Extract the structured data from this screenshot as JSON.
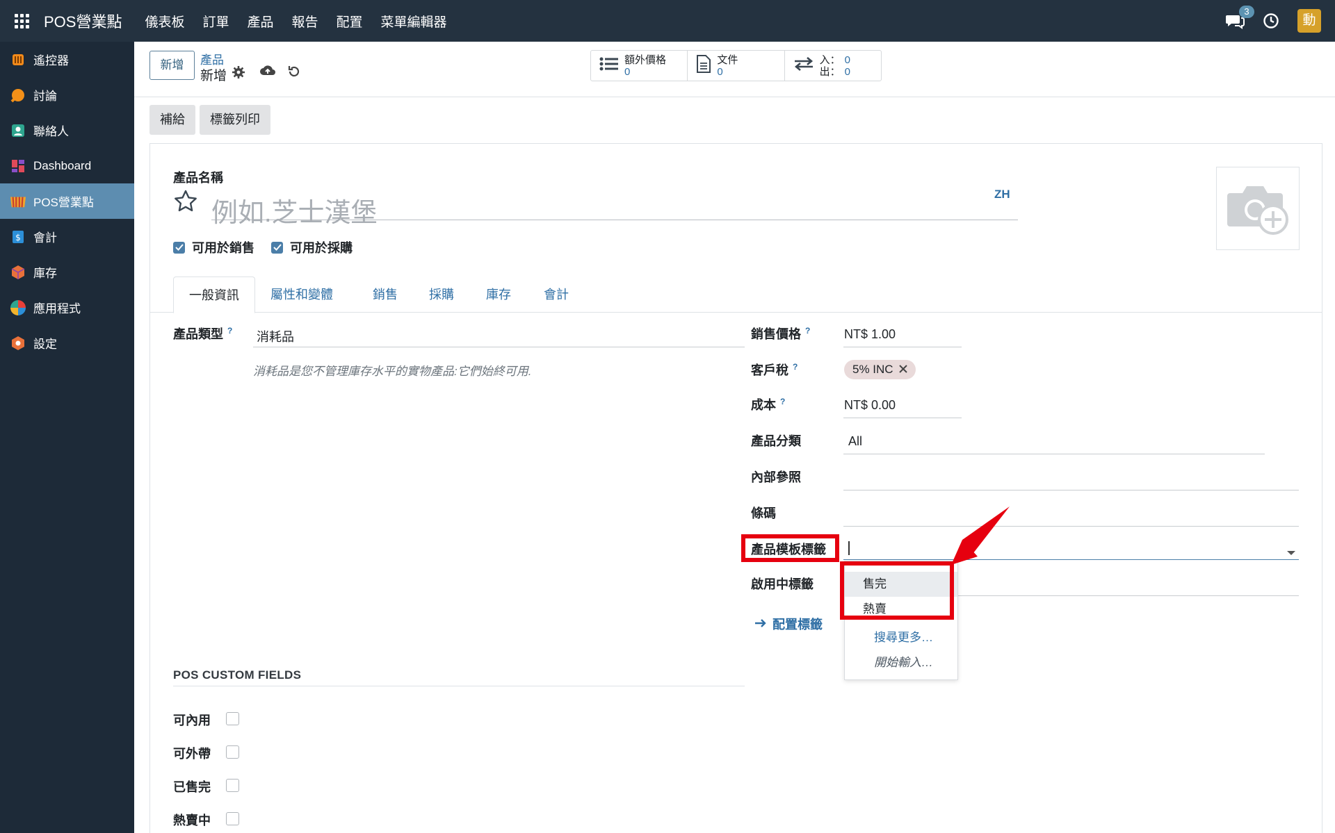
{
  "topbar": {
    "brand": "POS營業點",
    "menu": [
      "儀表板",
      "訂單",
      "產品",
      "報告",
      "配置",
      "菜單編輯器"
    ],
    "chat_badge": "3",
    "avatar_letter": "動"
  },
  "sidebar": {
    "items": [
      {
        "label": "遙控器",
        "icon": "remote-icon"
      },
      {
        "label": "討論",
        "icon": "discuss-icon"
      },
      {
        "label": "聯絡人",
        "icon": "contacts-icon"
      },
      {
        "label": "Dashboard",
        "icon": "dashboard-icon"
      },
      {
        "label": "POS營業點",
        "icon": "pos-icon",
        "active": true
      },
      {
        "label": "會計",
        "icon": "accounting-icon"
      },
      {
        "label": "庫存",
        "icon": "inventory-icon"
      },
      {
        "label": "應用程式",
        "icon": "apps-icon"
      },
      {
        "label": "設定",
        "icon": "settings-icon"
      }
    ]
  },
  "control_panel": {
    "new_button": "新增",
    "breadcrumb_parent": "產品",
    "breadcrumb_current": "新增",
    "smart_buttons": {
      "extra_price_label": "額外價格",
      "extra_price_value": "0",
      "documents_label": "文件",
      "documents_value": "0",
      "in_label": "入：",
      "in_value": "0",
      "out_label": "出：",
      "out_value": "0"
    }
  },
  "status_buttons": {
    "replenish": "補給",
    "print_labels": "標籤列印"
  },
  "form": {
    "product_name_label": "產品名稱",
    "product_name_placeholder": "例如.芝士漢堡",
    "lang": "ZH",
    "can_be_sold": "可用於銷售",
    "can_be_purchased": "可用於採購",
    "tabs": [
      "一般資訊",
      "屬性和變體",
      "銷售",
      "採購",
      "庫存",
      "會計"
    ],
    "product_type_label": "產品類型",
    "product_type_value": "消耗品",
    "product_type_hint": "消耗品是您不管理庫存水平的實物產品:它們始終可用.",
    "sales_price_label": "銷售價格",
    "sales_price_value": "NT$ 1.00",
    "customer_tax_label": "客戶稅",
    "customer_tax_tag": "5% INC",
    "cost_label": "成本",
    "cost_value": "NT$ 0.00",
    "category_label": "產品分類",
    "category_value": "All",
    "internal_ref_label": "內部參照",
    "barcode_label": "條碼",
    "template_tags_label": "產品模板標籤",
    "active_tags_label": "啟用中標籤",
    "configure_tags_link": "配置標籤",
    "tag_dropdown": {
      "options": [
        "售完",
        "熱賣"
      ],
      "search_more": "搜尋更多…",
      "start_typing": "開始輸入…"
    },
    "pos_section_title": "POS CUSTOM FIELDS",
    "pos_fields": [
      "可內用",
      "可外帶",
      "已售完",
      "熱賣中"
    ]
  },
  "colors": {
    "navbar": "#243240",
    "sidebar": "#1d2a38",
    "sidebar_active": "#5d8db0",
    "link": "#2f6fa5",
    "annotation_red": "#e6000f"
  }
}
